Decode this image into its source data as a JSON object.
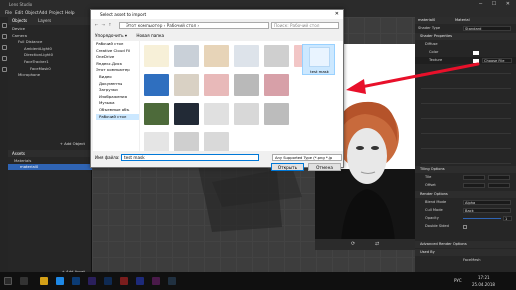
{
  "window": {
    "title": "Lens Studio"
  },
  "menu": {
    "items": [
      "File",
      "Edit",
      "Object",
      "Add",
      "Project",
      "Help"
    ]
  },
  "left": {
    "tabs": [
      "Objects",
      "Layers"
    ],
    "tree": [
      "Device",
      "Camera",
      "Full Distance",
      "AmbientLight0",
      "DirectionLight0",
      "FaceTracker1",
      "FaceMask0",
      "Microphone"
    ],
    "add_object": "+ Add Object",
    "assets_header": "Assets",
    "assets_tree": [
      "Materials",
      "material0"
    ],
    "add_asset": "+ Add Asset"
  },
  "dialog": {
    "title": "Select asset to import",
    "address": "Этот компьютер › Рабочий стол ›",
    "search_placeholder": "Поиск: Рабочий стол",
    "organize": "Упорядочить ▾",
    "new_folder": "Новая папка",
    "sidebar": [
      "Рабочий стол",
      "Creative Cloud Fil",
      "OneDrive",
      "Яндекс.Диск",
      "Этот компьютер",
      "Видео",
      "Документы",
      "Загрузки",
      "Изображения",
      "Музыка",
      "Объемные объ",
      "Рабочий стол"
    ],
    "selected_file_label": "test mask",
    "filename_label": "Имя файла:",
    "filename_value": "test mask",
    "filetype_value": "Any Supported Type (*.png *.jp",
    "open_button": "Открыть",
    "cancel_button": "Отмена"
  },
  "right": {
    "header": "material0",
    "header_type": "Material",
    "shader_type_label": "Shader Type",
    "shader_type_value": "Standard",
    "shader_properties": "Shader Properties",
    "diffuse": "Diffuse",
    "color_label": "Color",
    "texture_label": "Texture",
    "texture_value": "Choose File",
    "tiling_options": "Tiling Options",
    "tile_label": "Tile",
    "offset_label": "Offset",
    "render_options": "Render Options",
    "blend_mode_label": "Blend Mode",
    "blend_mode_value": "Alpha",
    "cull_mode_label": "Cull Mode",
    "cull_mode_value": "Back",
    "opacity_label": "Opacity",
    "opacity_value": "1",
    "two_sided_label": "Double Sided",
    "advanced": "Advanced Render Options",
    "used_by": "Used By",
    "used_by_value": "FaceMesh"
  },
  "taskbar": {
    "lang": "РУС",
    "time": "17:21",
    "date": "25.04.2018"
  },
  "colors": {
    "accent": "#2f64b4",
    "arrow": "#e8102a"
  }
}
